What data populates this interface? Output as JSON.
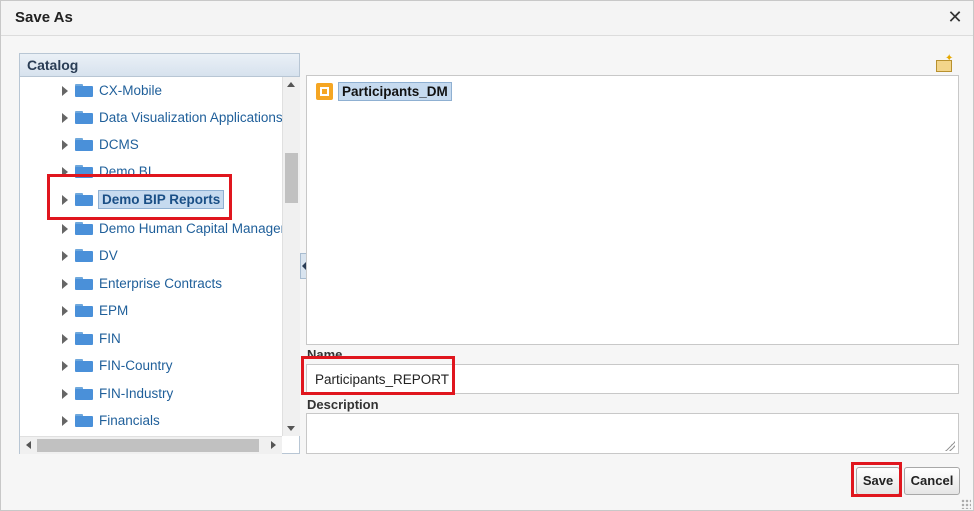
{
  "dialog": {
    "title": "Save As",
    "close_glyph": "✕"
  },
  "catalog": {
    "title": "Catalog",
    "items": [
      {
        "label": "CX-Mobile"
      },
      {
        "label": "Data Visualization Applications"
      },
      {
        "label": "DCMS"
      },
      {
        "label": "Demo BI"
      },
      {
        "label": "Demo BIP Reports",
        "selected": true
      },
      {
        "label": "Demo Human Capital Management"
      },
      {
        "label": "DV"
      },
      {
        "label": "Enterprise Contracts"
      },
      {
        "label": "EPM"
      },
      {
        "label": "FIN"
      },
      {
        "label": "FIN-Country"
      },
      {
        "label": "FIN-Industry"
      },
      {
        "label": "Financials"
      }
    ]
  },
  "files": {
    "items": [
      {
        "label": "Participants_DM",
        "icon": "data-model-icon",
        "selected": true
      }
    ]
  },
  "form": {
    "name_label": "Name",
    "name_value": "Participants_REPORT",
    "description_label": "Description",
    "description_value": ""
  },
  "buttons": {
    "save_label": "Save",
    "cancel_label": "Cancel"
  },
  "colors": {
    "highlight": "#e0161e",
    "link": "#1f5f9a",
    "selection": "#c6daef"
  }
}
